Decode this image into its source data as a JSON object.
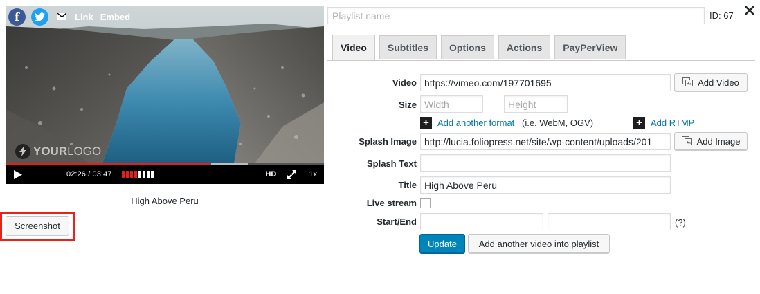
{
  "share": {
    "link_label": "Link",
    "embed_label": "Embed"
  },
  "player": {
    "logo_text_bold": "YOUR",
    "logo_text": "LOGO",
    "time_display": "02:26 / 03:47",
    "progress_fraction": 0.643,
    "buffer_fraction": 0.76,
    "volume_on_bars": 4,
    "volume_total_bars": 8,
    "quality_label": "HD",
    "speed_label": "1x"
  },
  "video_title": "High Above Peru",
  "screenshot_button": "Screenshot",
  "playlist": {
    "name_placeholder": "Playlist name",
    "id_label": "ID: 67"
  },
  "tabs": [
    {
      "label": "Video",
      "active": true
    },
    {
      "label": "Subtitles",
      "active": false
    },
    {
      "label": "Options",
      "active": false
    },
    {
      "label": "Actions",
      "active": false
    },
    {
      "label": "PayPerView",
      "active": false
    }
  ],
  "form": {
    "video_label": "Video",
    "video_value": "https://vimeo.com/197701695",
    "add_video_button": "Add Video",
    "size_label": "Size",
    "width_placeholder": "Width",
    "height_placeholder": "Height",
    "add_format_link": "Add another format",
    "add_format_hint": "(i.e. WebM, OGV)",
    "add_rtmp_link": "Add RTMP",
    "splash_image_label": "Splash Image",
    "splash_image_value": "http://lucia.foliopress.net/site/wp-content/uploads/201",
    "add_image_button": "Add Image",
    "splash_text_label": "Splash Text",
    "splash_text_value": "",
    "title_label": "Title",
    "title_value": "High Above Peru",
    "live_stream_label": "Live stream",
    "start_end_label": "Start/End",
    "start_value": "",
    "end_value": "",
    "start_end_help": "(?)",
    "update_button": "Update",
    "add_another_video_button": "Add another video into playlist"
  },
  "colors": {
    "facebook": "#3b5998",
    "twitter": "#1da1f2",
    "progress": "#e0201b",
    "primary_button": "#0085ba",
    "link": "#0073aa",
    "highlight": "#e8231b"
  }
}
